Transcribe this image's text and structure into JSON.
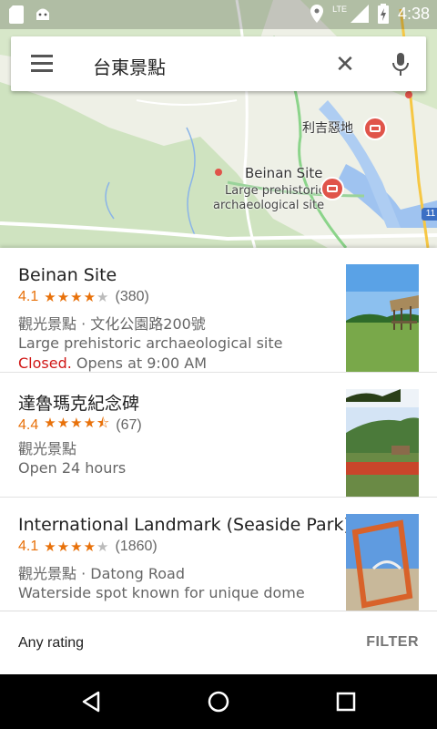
{
  "status_bar": {
    "time": "4:38",
    "network": "LTE"
  },
  "search": {
    "query": "台東景點"
  },
  "map": {
    "labels": {
      "lijijiedi": "利吉惡地",
      "beinan": "Beinan Site",
      "beinan_desc1": "Large prehistoric",
      "beinan_desc2": "archaeological site"
    },
    "route_shield": "11"
  },
  "results": [
    {
      "title": "Beinan Site",
      "rating": "4.1",
      "stars": 4.1,
      "count": "(380)",
      "meta": "觀光景點 · 文化公園路200號",
      "description": "Large prehistoric archaeological site",
      "status": "Closed.",
      "hours": "Opens at 9:00 AM"
    },
    {
      "title": "達魯瑪克紀念碑",
      "rating": "4.4",
      "stars": 4.4,
      "count": "(67)",
      "meta": "觀光景點",
      "hours": "Open 24 hours"
    },
    {
      "title": "International Landmark (Seaside Park)",
      "rating": "4.1",
      "stars": 4.1,
      "count": "(1860)",
      "meta": "觀光景點 · Datong Road",
      "description": "Waterside spot known for unique dome"
    }
  ],
  "filter_bar": {
    "any_rating": "Any rating",
    "filter": "FILTER"
  },
  "colors": {
    "accent": "#e8710a",
    "closed": "#d01716",
    "map_bg": "#eef0e6"
  }
}
